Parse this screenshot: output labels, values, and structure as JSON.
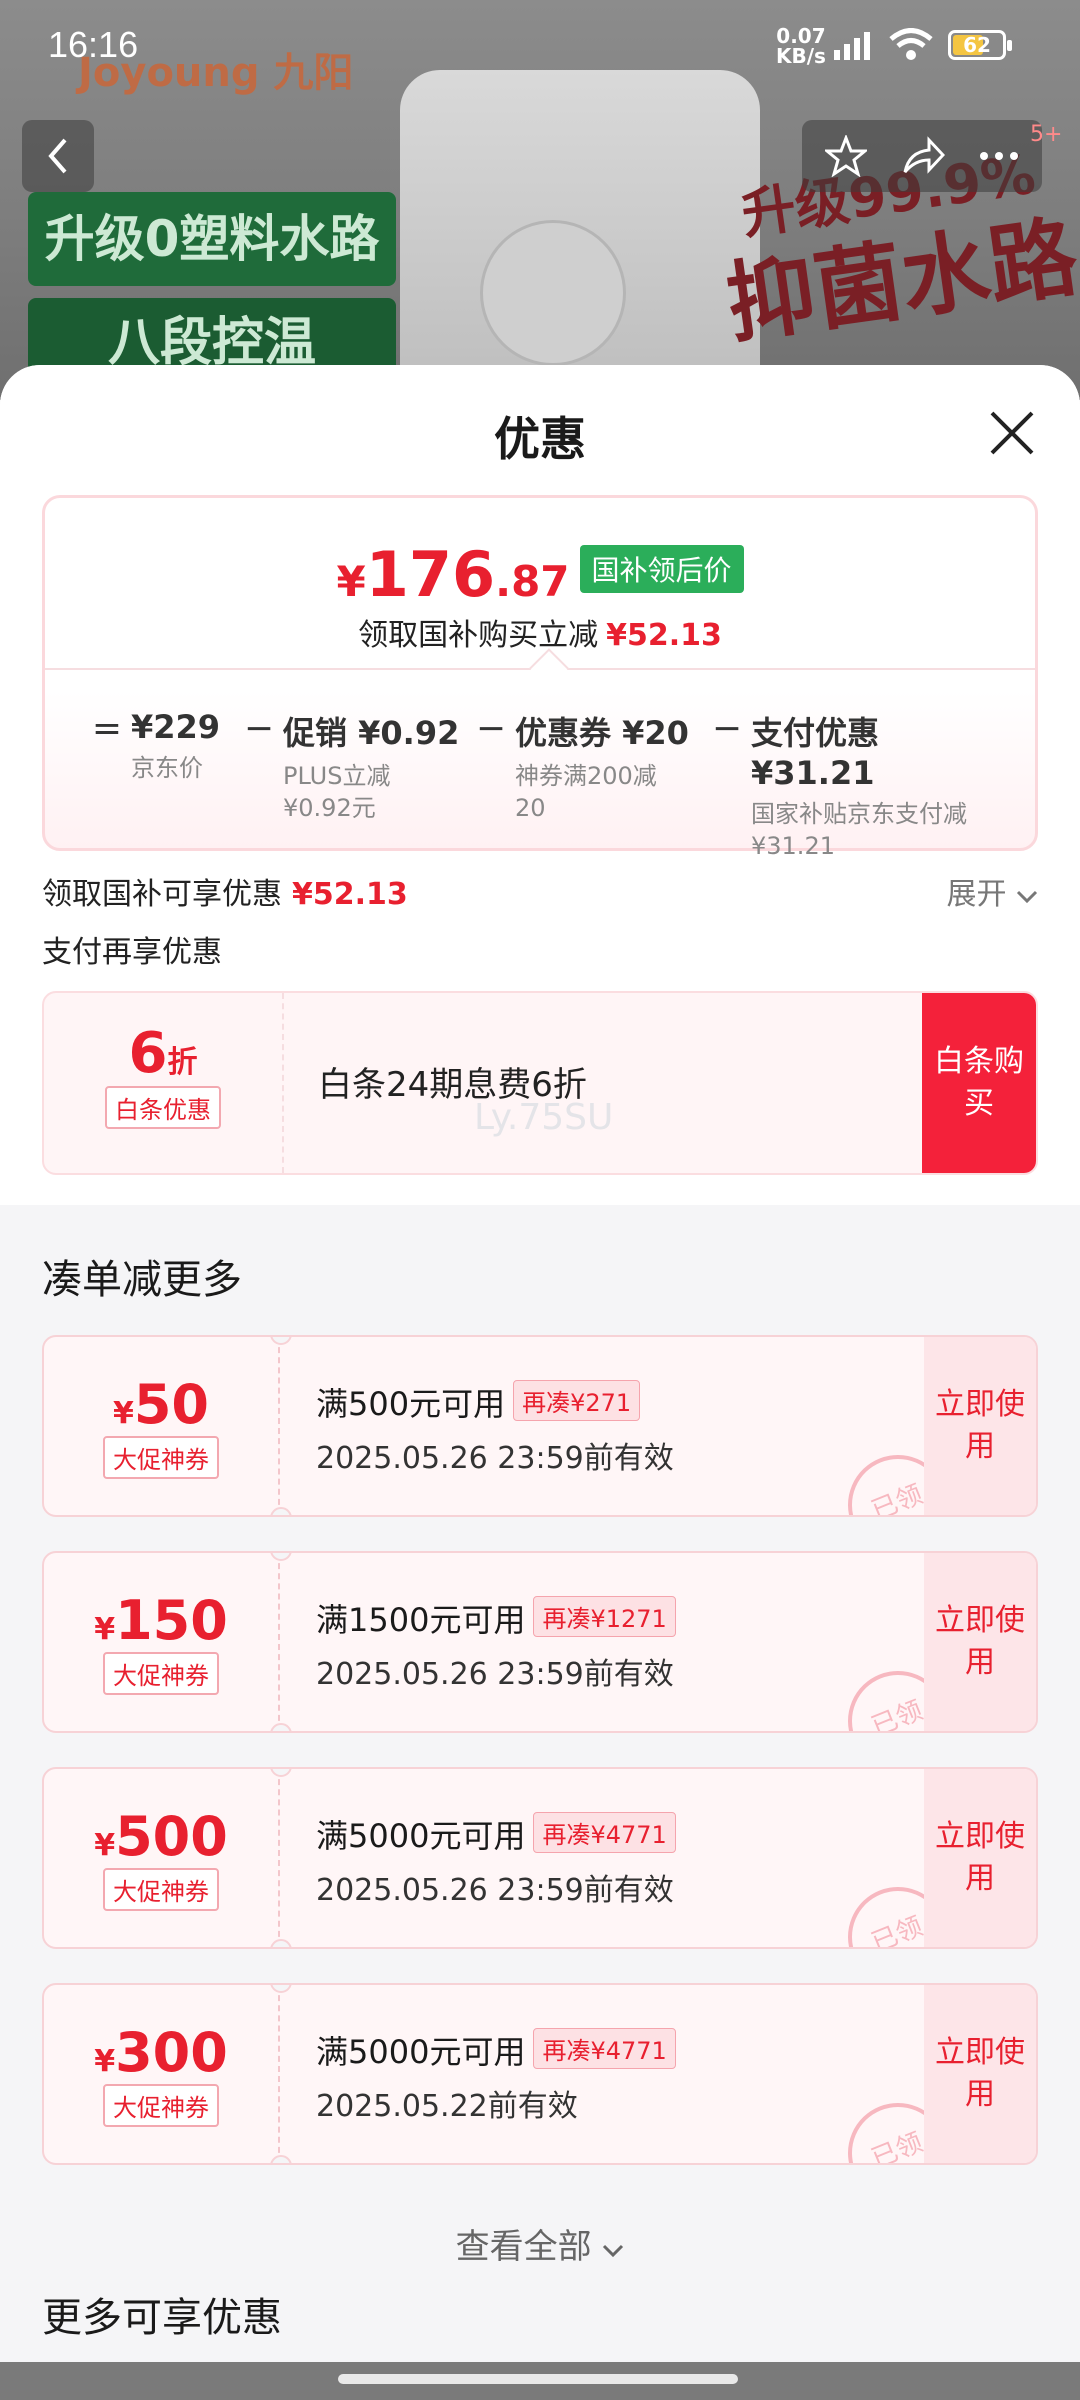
{
  "status_bar": {
    "time": "16:16",
    "net_speed": "0.07",
    "net_unit": "KB/s",
    "battery": "62",
    "battery_level": 0.62
  },
  "background": {
    "brand": "Joyoung 九阳",
    "banner_1": "升级0塑料水路",
    "banner_2": "八段控温",
    "promo_1": "升级99.9%",
    "promo_2": "抑菌水路",
    "badge": "5+"
  },
  "sheet": {
    "title": "优惠",
    "price": {
      "currency": "¥",
      "integer": "176",
      "decimal": ".87",
      "tag": "国补领后价",
      "subtitle": "领取国补购买立减",
      "subtitle_amount": "¥52.13"
    },
    "formula": {
      "equals": "=",
      "minus": "−",
      "items": [
        {
          "title": "¥229",
          "sub": "京东价"
        },
        {
          "title": "促销 ¥0.92",
          "sub": "PLUS立减¥0.92元"
        },
        {
          "title": "优惠券 ¥20",
          "sub": "神券满200减20"
        },
        {
          "title": "支付优惠 ¥31.21",
          "sub": "国家补贴京东支付减¥31.21"
        }
      ]
    },
    "summary": {
      "label": "领取国补可享优惠",
      "amount": "¥52.13",
      "expand": "展开"
    },
    "pay_label": "支付再享优惠",
    "baitiao": {
      "discount_value": "6",
      "discount_unit": "折",
      "chip": "白条优惠",
      "desc": "白条24期息费6折",
      "watermark": "Ly.75SU",
      "button": "白条购买"
    },
    "section_title": "凑单减更多",
    "coupons": [
      {
        "yen": "¥",
        "amount": "50",
        "chip": "大促神券",
        "cond": "满500元可用",
        "again": "再凑¥271",
        "expire": "2025.05.26 23:59前有效",
        "button": "立即使用",
        "stamp": "已领"
      },
      {
        "yen": "¥",
        "amount": "150",
        "chip": "大促神券",
        "cond": "满1500元可用",
        "again": "再凑¥1271",
        "expire": "2025.05.26 23:59前有效",
        "button": "立即使用",
        "stamp": "已领"
      },
      {
        "yen": "¥",
        "amount": "500",
        "chip": "大促神券",
        "cond": "满5000元可用",
        "again": "再凑¥4771",
        "expire": "2025.05.26 23:59前有效",
        "button": "立即使用",
        "stamp": "已领"
      },
      {
        "yen": "¥",
        "amount": "300",
        "chip": "大促神券",
        "cond": "满5000元可用",
        "again": "再凑¥4771",
        "expire": "2025.05.22前有效",
        "button": "立即使用",
        "stamp": "已领"
      }
    ],
    "view_all": "查看全部",
    "more_title": "更多可享优惠"
  },
  "colors": {
    "accent_red": "#e8202f",
    "button_red": "#f4213a",
    "tag_green": "#2bae5a"
  },
  "icons": {
    "back": "chevron-left-icon",
    "star": "star-icon",
    "share": "share-icon",
    "close": "close-icon",
    "expand": "chevron-down-icon"
  }
}
